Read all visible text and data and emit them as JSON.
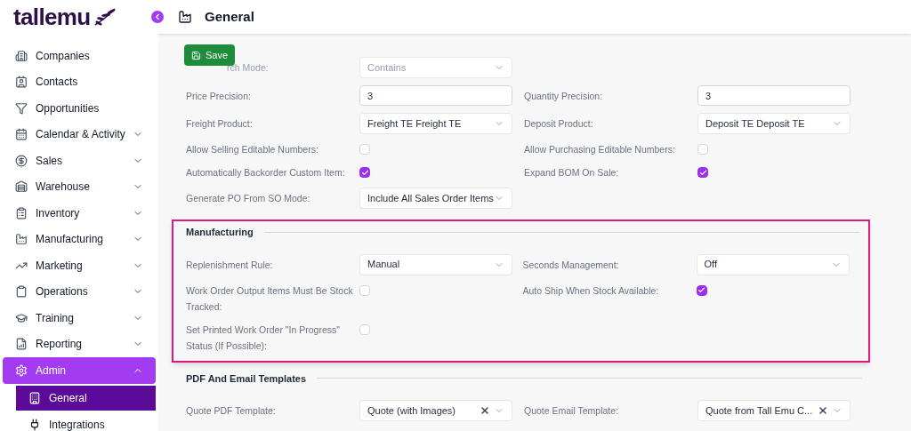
{
  "logo": {
    "text": "tallemu"
  },
  "header": {
    "title": "General"
  },
  "save_button": {
    "label": "Save"
  },
  "sidebar": {
    "items": [
      {
        "label": "Companies",
        "selected": false
      },
      {
        "label": "Contacts",
        "selected": false
      },
      {
        "label": "Opportunities",
        "selected": false
      },
      {
        "label": "Calendar & Activity",
        "selected": false,
        "expanded": false
      },
      {
        "label": "Sales",
        "selected": false,
        "expanded": false
      },
      {
        "label": "Warehouse",
        "selected": false,
        "expanded": false
      },
      {
        "label": "Inventory",
        "selected": false,
        "expanded": false
      },
      {
        "label": "Manufacturing",
        "selected": false,
        "expanded": false
      },
      {
        "label": "Marketing",
        "selected": false,
        "expanded": false
      },
      {
        "label": "Operations",
        "selected": false,
        "expanded": false
      },
      {
        "label": "Training",
        "selected": false,
        "expanded": false
      },
      {
        "label": "Reporting",
        "selected": false,
        "expanded": false
      },
      {
        "label": "Admin",
        "selected": true,
        "expanded": true,
        "children": [
          {
            "label": "General",
            "selected": true
          },
          {
            "label": "Integrations",
            "selected": false
          }
        ]
      }
    ]
  },
  "sections": [
    {
      "highlighted": false,
      "rows": [
        [
          {
            "label": "rch Mode:",
            "kind": "select",
            "value": "Contains",
            "faded": true
          }
        ],
        [
          {
            "label": "Price Precision:",
            "kind": "text",
            "value": "3"
          },
          {
            "label": "Quantity Precision:",
            "kind": "text",
            "value": "3"
          }
        ],
        [
          {
            "label": "Freight Product:",
            "kind": "select",
            "value": "Freight TE Freight TE"
          },
          {
            "label": "Deposit Product:",
            "kind": "select",
            "value": "Deposit TE Deposit TE"
          }
        ],
        [
          {
            "label": "Allow Selling Editable Numbers:",
            "kind": "checkbox",
            "checked": false
          },
          {
            "label": "Allow Purchasing Editable Numbers:",
            "kind": "checkbox",
            "checked": false
          }
        ],
        [
          {
            "label": "Automatically Backorder Custom Item:",
            "kind": "checkbox",
            "checked": true
          },
          {
            "label": "Expand BOM On Sale:",
            "kind": "checkbox",
            "checked": true
          }
        ],
        [
          {
            "label": "Generate PO From SO Mode:",
            "kind": "select",
            "value": "Include All Sales Order Items"
          }
        ]
      ]
    },
    {
      "title": "Manufacturing",
      "highlighted": true,
      "rows": [
        [
          {
            "label": "Replenishment Rule:",
            "kind": "select",
            "value": "Manual"
          },
          {
            "label": "Seconds Management:",
            "kind": "select",
            "value": "Off"
          }
        ],
        [
          {
            "label": "Work Order Output Items Must Be Stock Tracked:",
            "kind": "checkbox",
            "checked": false
          },
          {
            "label": "Auto Ship When Stock Available:",
            "kind": "checkbox",
            "checked": true
          }
        ],
        [
          {
            "label": "Set Printed Work Order \"In Progress\" Status (If Possible):",
            "kind": "checkbox",
            "checked": false
          }
        ]
      ]
    },
    {
      "title": "PDF And Email Templates",
      "highlighted": false,
      "rows": [
        [
          {
            "label": "Quote PDF Template:",
            "kind": "select",
            "value": "Quote (with Images)",
            "clearable": true
          },
          {
            "label": "Quote Email Template:",
            "kind": "select",
            "value": "Quote from Tall Emu C...",
            "clearable": true
          }
        ]
      ]
    }
  ]
}
